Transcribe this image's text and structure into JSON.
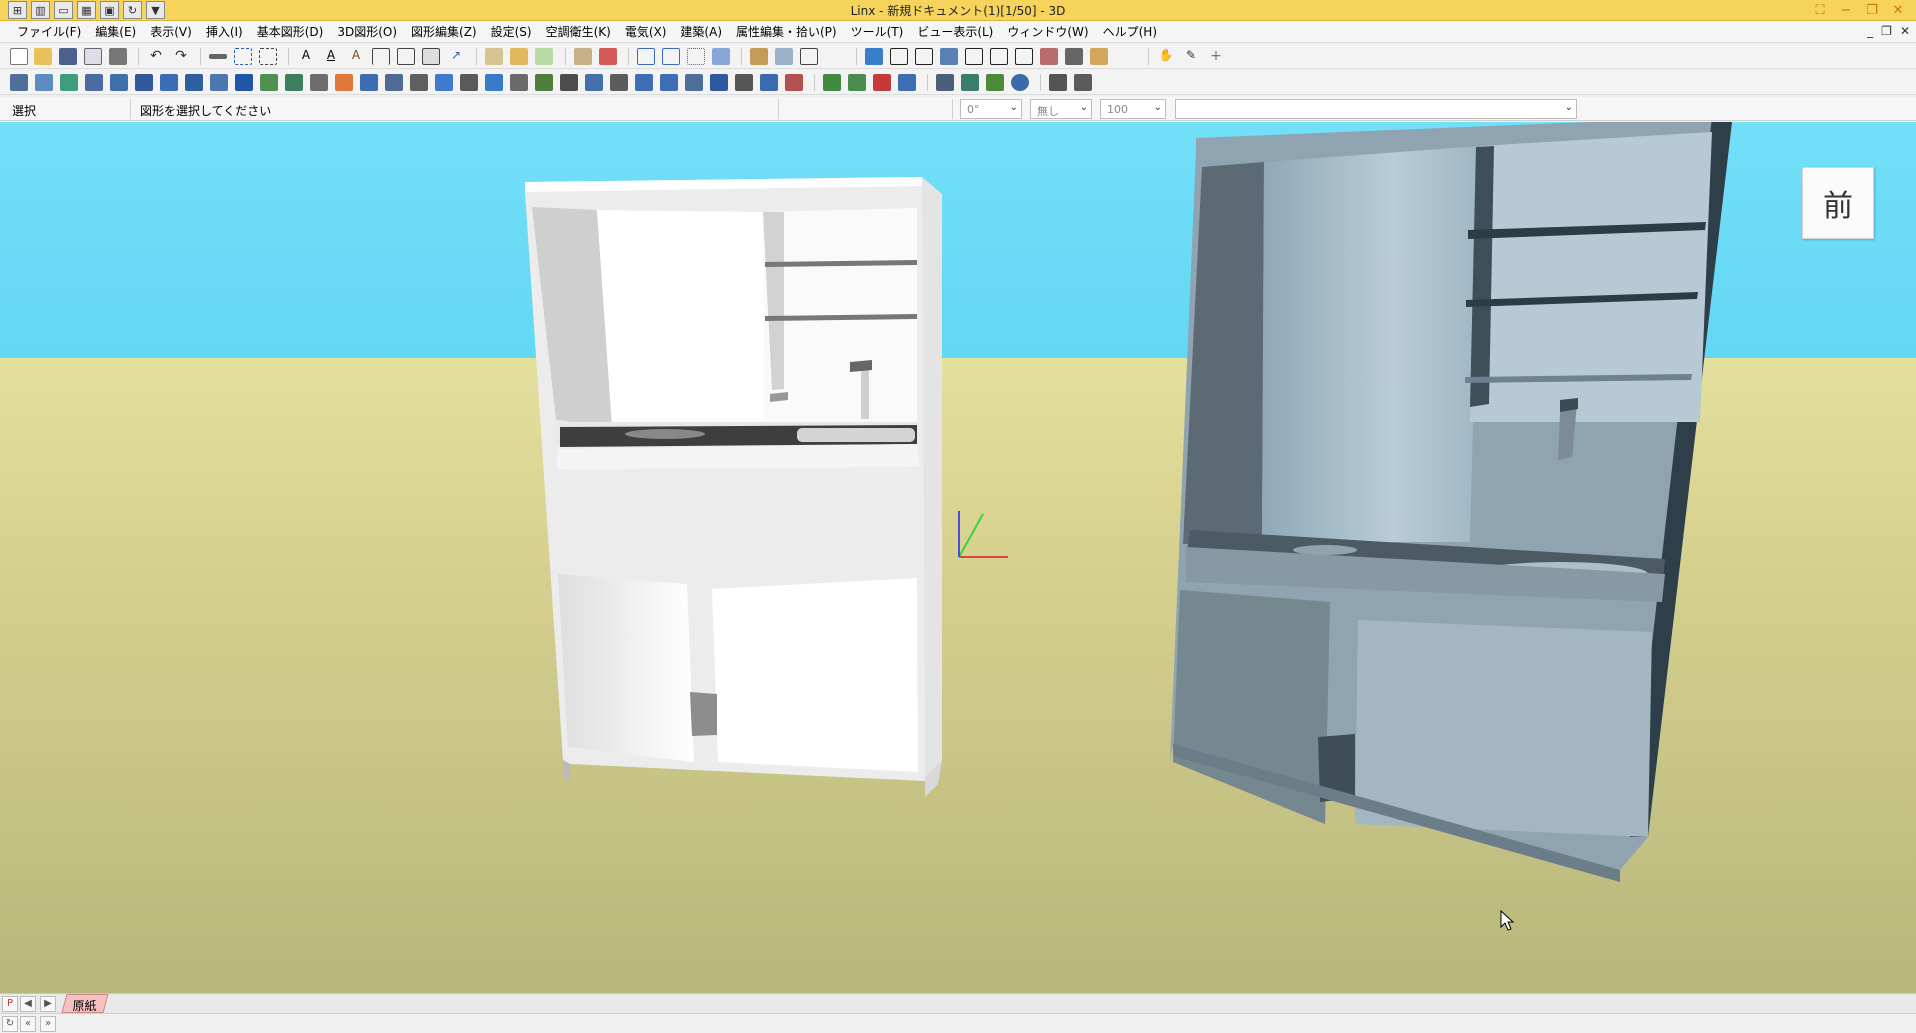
{
  "window": {
    "title": "Linx - 新規ドキュメント(1)[1/50] - 3D"
  },
  "menu": {
    "items": [
      "ファイル(F)",
      "編集(E)",
      "表示(V)",
      "挿入(I)",
      "基本図形(D)",
      "3D図形(O)",
      "図形編集(Z)",
      "設定(S)",
      "空調衛生(K)",
      "電気(X)",
      "建築(A)",
      "属性編集・拾い(P)",
      "ツール(T)",
      "ビュー表示(L)",
      "ウィンドウ(W)",
      "ヘルプ(H)"
    ]
  },
  "propbar": {
    "mode": "選択",
    "message": "図形を選択してください",
    "angle": "0°",
    "line_style": "無し",
    "scale": "100",
    "layer": ""
  },
  "viewport": {
    "view_label": "前",
    "sky_color": "#6bdbf6",
    "ground_color": "#d0cb8c"
  },
  "sheets": {
    "active": "原紙"
  }
}
